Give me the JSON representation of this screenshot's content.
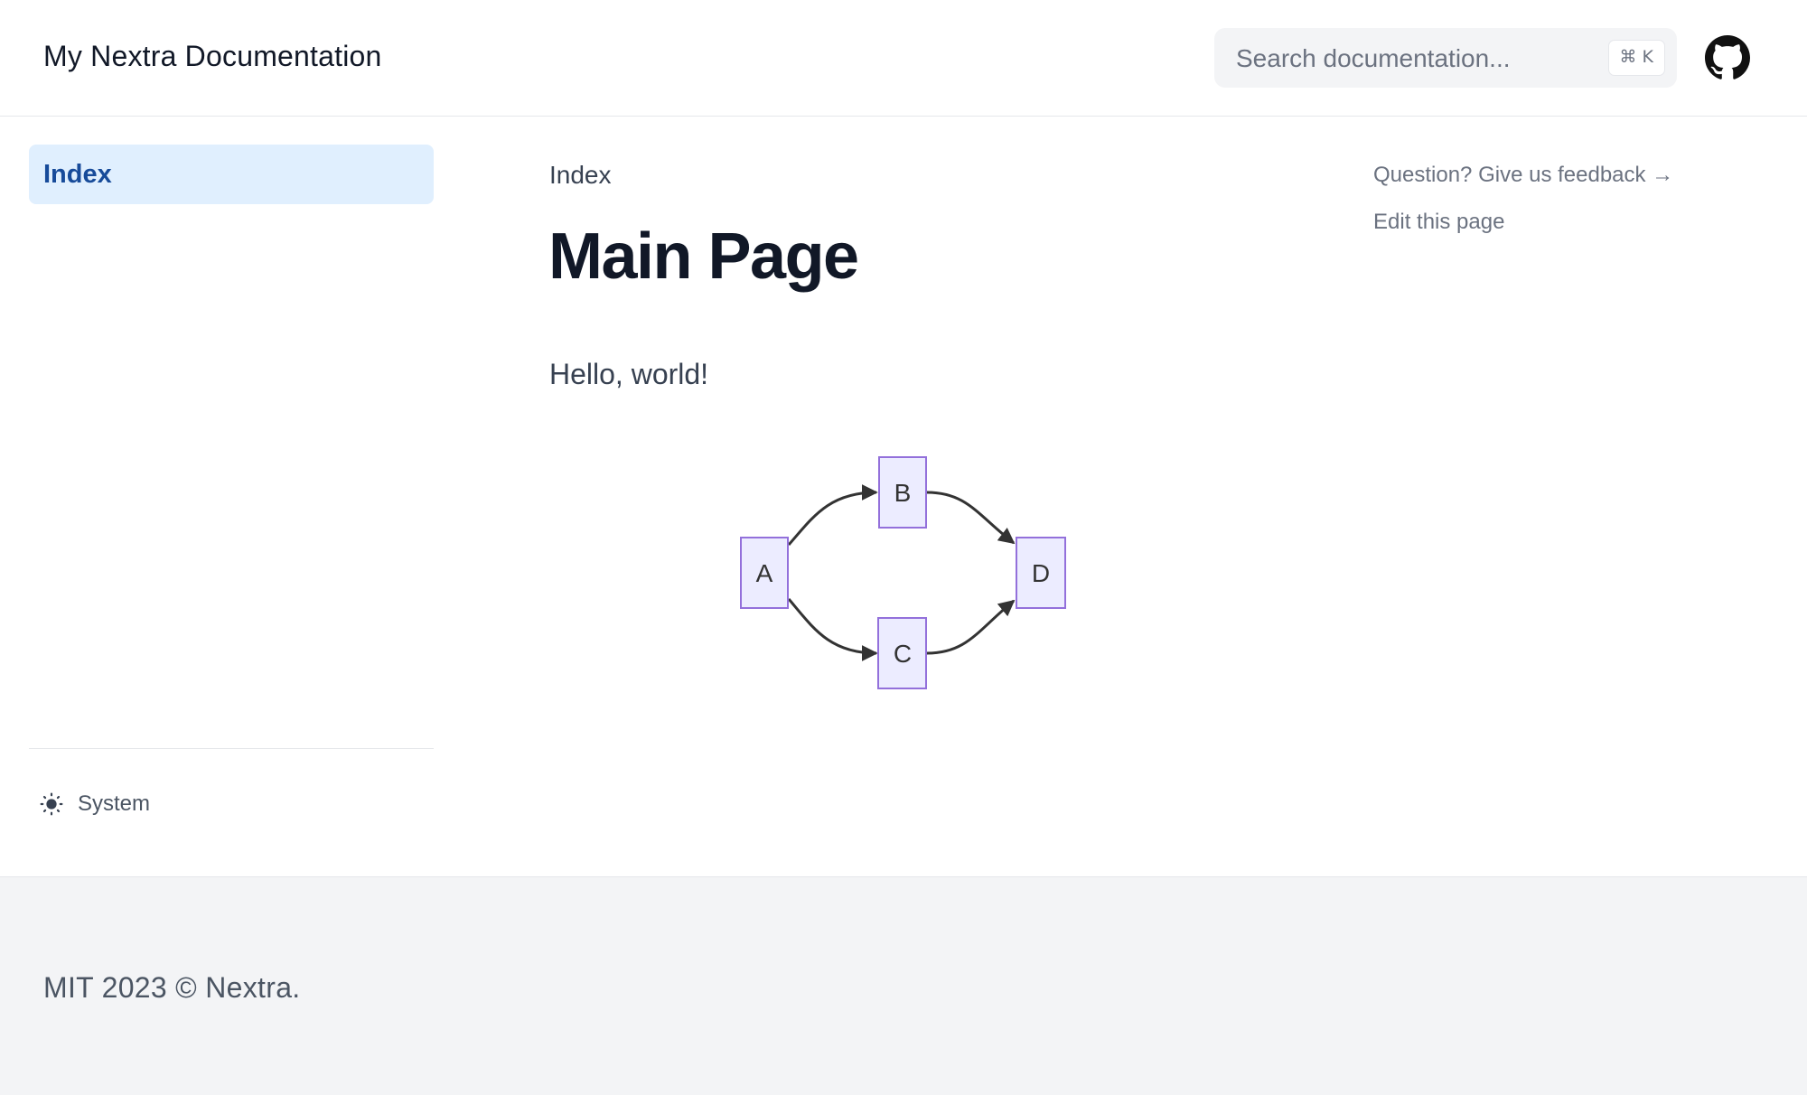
{
  "navbar": {
    "title": "My Nextra Documentation",
    "search": {
      "placeholder": "Search documentation...",
      "shortcut": "⌘ K"
    },
    "github_icon": "github-icon"
  },
  "sidebar": {
    "items": [
      {
        "label": "Index",
        "active": true
      }
    ],
    "theme": {
      "label": "System",
      "icon": "sun-icon"
    }
  },
  "main": {
    "breadcrumb": "Index",
    "title": "Main Page",
    "paragraph": "Hello, world!",
    "diagram": {
      "nodes": [
        "A",
        "B",
        "C",
        "D"
      ],
      "edges": [
        [
          "A",
          "B"
        ],
        [
          "A",
          "C"
        ],
        [
          "B",
          "D"
        ],
        [
          "C",
          "D"
        ]
      ],
      "node_fill": "#ececff",
      "node_stroke": "#9370db",
      "edge_color": "#333333"
    }
  },
  "toc": {
    "feedback": "Question? Give us feedback →",
    "edit": "Edit this page"
  },
  "footer": {
    "text": "MIT 2023 © Nextra."
  },
  "colors": {
    "accent_bg": "#e0effe",
    "accent_text": "#174b9a",
    "muted_text": "#6b7280"
  }
}
